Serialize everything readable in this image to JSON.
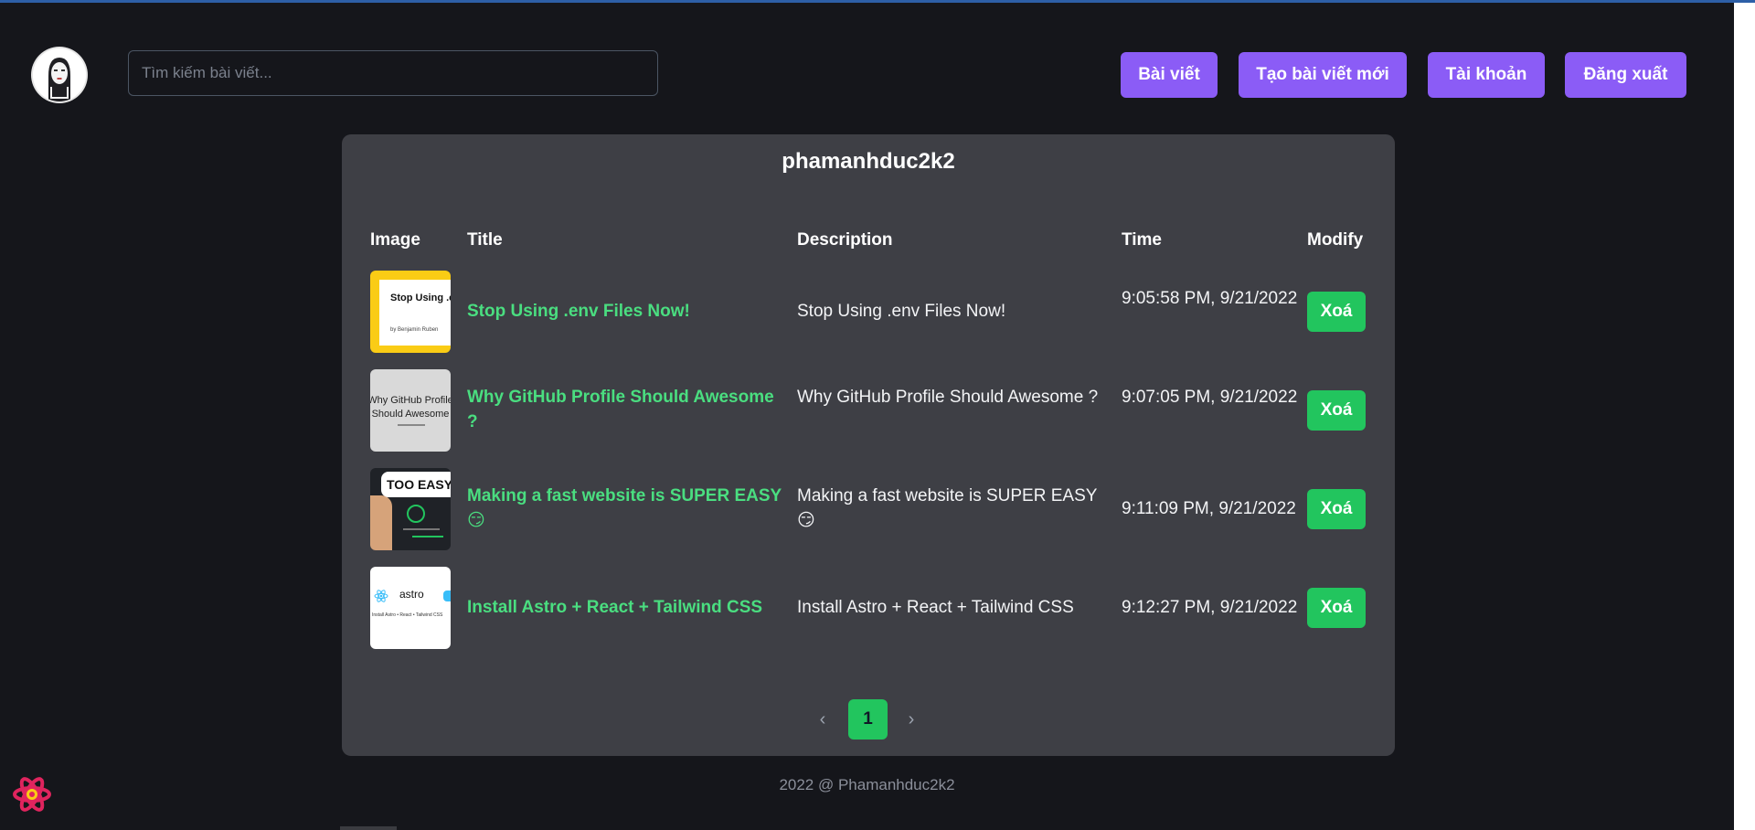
{
  "search": {
    "placeholder": "Tìm kiếm bài viết..."
  },
  "nav": {
    "posts": "Bài viết",
    "create": "Tạo bài viết mới",
    "account": "Tài khoản",
    "logout": "Đăng xuất"
  },
  "profile": {
    "username": "phamanhduc2k2"
  },
  "table": {
    "headers": {
      "image": "Image",
      "title": "Title",
      "description": "Description",
      "time": "Time",
      "modify": "Modify"
    },
    "rows": [
      {
        "title": "Stop Using .env Files Now!",
        "description": "Stop Using .env Files Now!",
        "time": "9:05:58 PM, 9/21/2022",
        "action": "Xoá",
        "thumb_text": "Stop Using .env Files Now!",
        "thumb_sub": "by Benjamin Ruben"
      },
      {
        "title": "Why GitHub Profile Should Awesome ?",
        "description": "Why GitHub Profile Should Awesome ?",
        "time": "9:07:05 PM, 9/21/2022",
        "action": "Xoá",
        "thumb_text": "Why GitHub Profile Should Awesome"
      },
      {
        "title": "Making a fast website is SUPER EASY 😏",
        "description": "Making a fast website is SUPER EASY 😏",
        "time": "9:11:09 PM, 9/21/2022",
        "action": "Xoá",
        "thumb_text": "TOO EASY"
      },
      {
        "title": "Install Astro + React + Tailwind CSS",
        "description": "Install Astro + React + Tailwind CSS",
        "time": "9:12:27 PM, 9/21/2022",
        "action": "Xoá",
        "thumb_text": "astro",
        "thumb_sub": "Install Astro • React • Tailwind CSS"
      }
    ]
  },
  "pagination": {
    "prev": "‹",
    "current": "1",
    "next": "›"
  },
  "footer": {
    "text": "2022 @ Phamanhduc2k2"
  },
  "colors": {
    "accent": "#8b5cf6",
    "success": "#22c55e",
    "title_link": "#4ade80",
    "card": "#3e3f45",
    "background": "#15161b"
  },
  "icons": {
    "avatar": "masked-character-avatar",
    "devtools": "react-devtools-icon"
  }
}
